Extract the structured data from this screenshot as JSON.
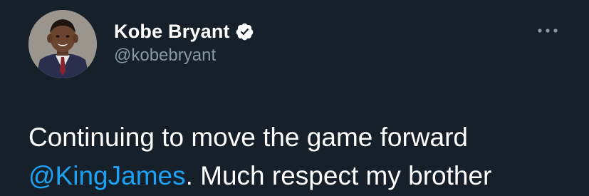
{
  "user": {
    "display_name": "Kobe Bryant",
    "handle": "@kobebryant",
    "verified": true,
    "avatar_icon": "profile-photo-child-in-school-uniform"
  },
  "tweet": {
    "line1": "Continuing to move the game forward",
    "mention": "@KingJames",
    "line2_rest": ". Much respect my brother"
  },
  "menu": {
    "icon": "more-options-icon"
  },
  "colors": {
    "background": "#15202b",
    "primary_text": "#ffffff",
    "secondary_text": "#8899a6",
    "link": "#1da1f2"
  }
}
